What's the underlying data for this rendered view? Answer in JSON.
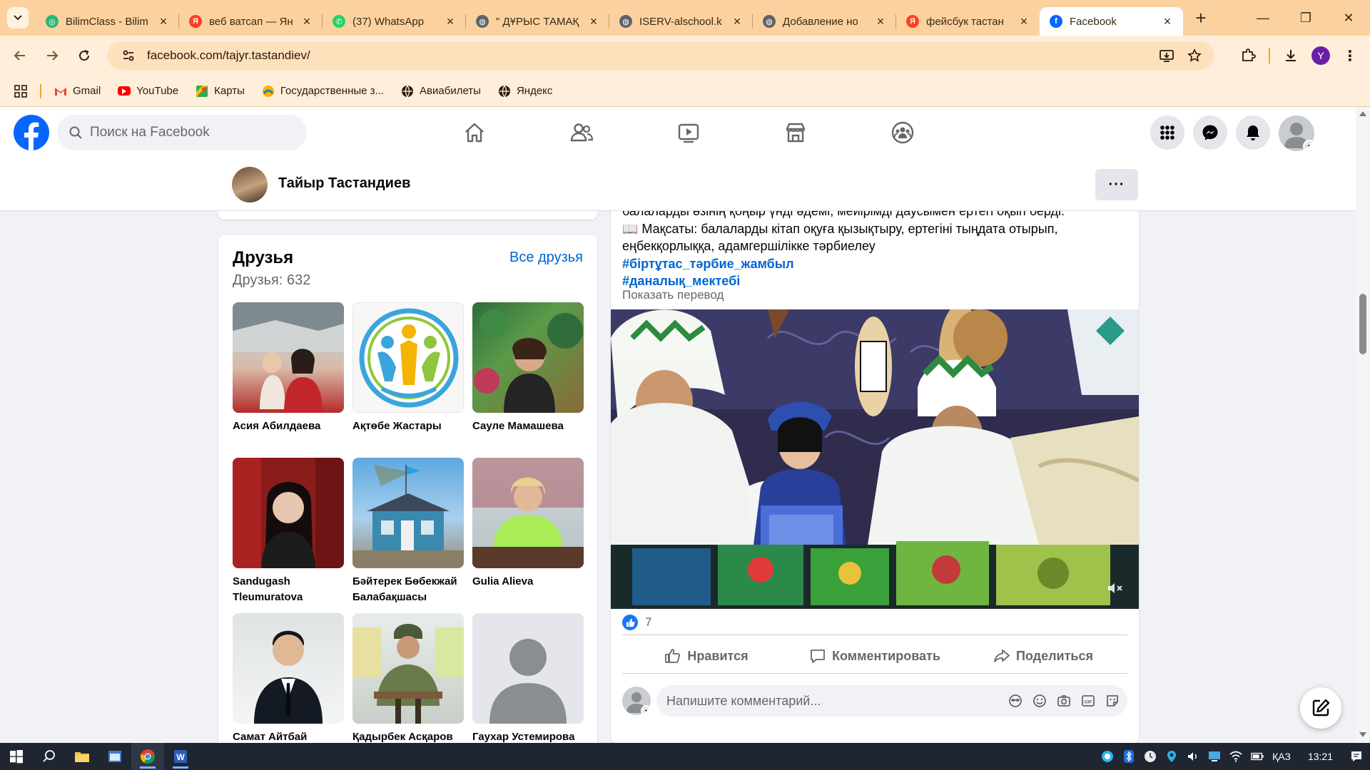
{
  "browser": {
    "tabs": [
      {
        "title": "BilimClass - Bilim",
        "favicon_color": "#2bb673",
        "active": false
      },
      {
        "title": "веб ватсап — Ян",
        "favicon_color": "#fc3f1d",
        "active": false
      },
      {
        "title": "(37) WhatsApp",
        "favicon_color": "#25d366",
        "active": false
      },
      {
        "title": "\" ДҰРЫС ТАМАҚ",
        "favicon_color": "#5f6368",
        "active": false
      },
      {
        "title": "ISERV-alschool.k",
        "favicon_color": "#5f6368",
        "active": false
      },
      {
        "title": "Добавление но",
        "favicon_color": "#5f6368",
        "active": false
      },
      {
        "title": "фейсбук тастан",
        "favicon_color": "#fc3f1d",
        "active": false
      },
      {
        "title": "Facebook",
        "favicon_color": "#0866ff",
        "active": true
      }
    ],
    "url": "facebook.com/tajyr.tastandiev/",
    "profile_initial": "Y",
    "bookmarks": [
      {
        "label": "Gmail",
        "icon": "gmail-icon"
      },
      {
        "label": "YouTube",
        "icon": "youtube-icon"
      },
      {
        "label": "Карты",
        "icon": "maps-icon"
      },
      {
        "label": "Государственные з...",
        "icon": "gov-icon"
      },
      {
        "label": "Авиабилеты",
        "icon": "globe-icon"
      },
      {
        "label": "Яндекс",
        "icon": "globe-icon"
      }
    ]
  },
  "facebook": {
    "search_placeholder": "Поиск на Facebook",
    "profile_name": "Тайыр Тастандиев",
    "friends": {
      "title": "Друзья",
      "all_link": "Все друзья",
      "count": "Друзья: 632",
      "items": [
        {
          "name": "Асия Абилдаева"
        },
        {
          "name": "Ақтөбе Жастары"
        },
        {
          "name": "Сауле Мамашева"
        },
        {
          "name": "Sandugash Tleumuratova"
        },
        {
          "name": "Бәйтерек Бөбекжай Балабақшасы"
        },
        {
          "name": "Gulia Alieva"
        },
        {
          "name": "Самат Айтбай"
        },
        {
          "name": "Қадырбек Асқаров"
        },
        {
          "name": "Гаухар Устемирова"
        }
      ]
    },
    "post": {
      "text_line1": "балаларды өзінің қоңыр үнді әдемі, мейірімді даусымен ертегі оқып берді.",
      "text_line2": "📖 Мақсаты: балаларды кітап оқуға қызықтыру, ертегіні тыңдата отырып,",
      "text_line3": "еңбекқорлыққа, адамгершілікке тәрбиелеу",
      "hashtag1": "#біртұтас_тәрбие_жамбыл",
      "hashtag2": "#даналық_мектебі",
      "show_translation": "Показать перевод",
      "likes": "7",
      "actions": {
        "like": "Нравится",
        "comment": "Комментировать",
        "share": "Поделиться"
      },
      "comment_placeholder": "Напишите комментарий..."
    }
  },
  "taskbar": {
    "lang": "ҚАЗ",
    "time": "13:21"
  }
}
